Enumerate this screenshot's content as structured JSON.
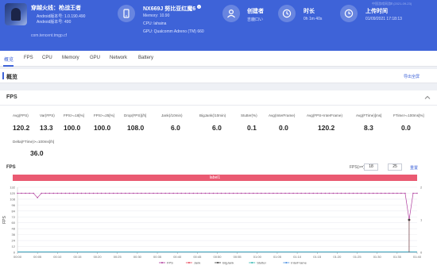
{
  "header": {
    "game_title": "穿越火线：枪战王者",
    "android_version": "Android版本号: 1.0.190.490",
    "android_build": "Android版本号: 490",
    "package": "com.tencent.tmgp.cf",
    "device": {
      "name": "NX669J 努比亚红魔6",
      "memory": "Memory: 10.90",
      "cpu": "CPU: lahaina",
      "gpu": "GPU: Qualcomm Adreno (TM) 660"
    },
    "creator": {
      "title": "创建者",
      "value": "吉鹿口い"
    },
    "duration": {
      "title": "时长",
      "value": "0h 1m 40s"
    },
    "upload": {
      "title": "上传时间",
      "value": "01/09/2021 17:18:13"
    },
    "watermark": "中国游戏网游Ⅱ (2021-09-23)"
  },
  "tabs": [
    "概览",
    "FPS",
    "CPU",
    "Memory",
    "GPU",
    "Network",
    "Battery"
  ],
  "overview": {
    "title": "概览",
    "link": "导出全屏"
  },
  "fps_card": {
    "title": "FPS",
    "metrics": [
      {
        "label": "Avg(FPS)",
        "value": "120.2"
      },
      {
        "label": "Var(FPS)",
        "value": "13.3"
      },
      {
        "label": "FPS>=18[%]",
        "value": "100.0"
      },
      {
        "label": "FPS>=25[%]",
        "value": "100.0"
      },
      {
        "label": "Drop(FPS)[/h]",
        "value": "108.0"
      },
      {
        "label": "Jank(/10min)",
        "value": "6.0"
      },
      {
        "label": "BigJank(/10min)",
        "value": "6.0"
      },
      {
        "label": "Stutter(%)",
        "value": "0.1"
      },
      {
        "label": "Avg(InterFrame)",
        "value": "0.0"
      },
      {
        "label": "Avg(FPS+InterFrame)",
        "value": "120.2"
      },
      {
        "label": "Avg(FTime)[ms]",
        "value": "8.3"
      },
      {
        "label": "FTime>=100ms[%]",
        "value": "0.0"
      }
    ],
    "delta": {
      "label": "Delta(FTime)>=100ms[/h]",
      "value": "36.0"
    },
    "chart_label": "FPS",
    "range_label": "FPS(>=)",
    "range_values": [
      "18",
      "25"
    ],
    "reset_link": "重置",
    "label_bar": "label1",
    "icon": "collapse-icon"
  },
  "colors": {
    "header": "#3e63d8",
    "fps": "#b03d9e",
    "jank": "#e8495c",
    "bigjank": "#3d3d3d",
    "stutter": "#2fb6b0",
    "interframe": "#4a8fe0",
    "accent": "#3e63d8"
  },
  "chart_data": {
    "type": "line",
    "title": "",
    "xlabel": "",
    "ylabel": "FPS",
    "ylabel_right": "",
    "ylim": [
      0,
      132
    ],
    "y2lim": [
      0,
      2
    ],
    "yticks": [
      0,
      12,
      24,
      36,
      48,
      60,
      72,
      84,
      96,
      108,
      120,
      132
    ],
    "y2ticks": [
      0,
      1,
      2
    ],
    "categories": [
      "00:00",
      "00:05",
      "00:10",
      "00:15",
      "00:20",
      "00:25",
      "00:30",
      "00:35",
      "00:40",
      "00:45",
      "00:50",
      "00:55",
      "01:00",
      "01:05",
      "01:10",
      "01:15",
      "01:20",
      "01:25",
      "01:30",
      "01:35",
      "01:40"
    ],
    "legend_position": "bottom",
    "grid": true,
    "series": [
      {
        "name": "FPS",
        "axis": "left",
        "values": [
          120,
          120,
          120,
          120,
          120,
          111,
          120,
          120,
          120,
          120,
          120,
          120,
          120,
          120,
          120,
          120,
          120,
          120,
          120,
          120,
          120,
          120,
          120,
          120,
          120,
          120,
          120,
          120,
          120,
          120,
          120,
          120,
          120,
          120,
          120,
          120,
          120,
          120,
          120,
          120,
          120,
          120,
          120,
          120,
          120,
          120,
          120,
          120,
          120,
          120,
          120,
          120,
          120,
          120,
          120,
          120,
          120,
          120,
          120,
          120,
          120,
          120,
          120,
          120,
          120,
          120,
          120,
          120,
          120,
          120,
          120,
          120,
          120,
          120,
          120,
          120,
          120,
          120,
          120,
          120,
          120,
          120,
          120,
          120,
          120,
          120,
          120,
          120,
          120,
          120,
          120,
          120,
          120,
          120,
          120,
          120,
          120,
          120,
          66,
          120,
          120
        ]
      },
      {
        "name": "Jank",
        "axis": "right",
        "points": [
          [
            98,
            1
          ]
        ]
      },
      {
        "name": "BigJank",
        "axis": "right",
        "points": [
          [
            98,
            1
          ]
        ]
      },
      {
        "name": "Stutter",
        "axis": "right",
        "points": []
      },
      {
        "name": "InterFrame",
        "axis": "right",
        "points": []
      }
    ]
  }
}
